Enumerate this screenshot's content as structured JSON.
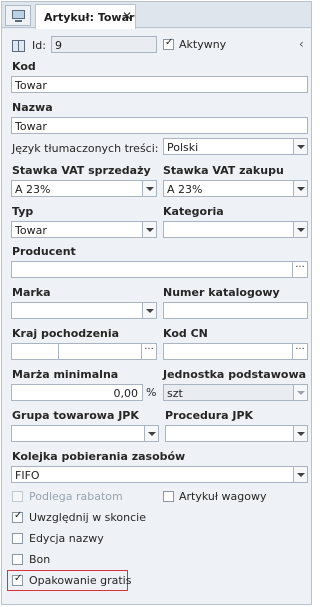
{
  "tab": {
    "title": "Artykuł: Towar",
    "close": "✕"
  },
  "header": {
    "id_label": "Id:",
    "id_value": "9",
    "aktywny_label": "Aktywny",
    "collapse": "‹"
  },
  "fields": {
    "kod": {
      "label": "Kod",
      "value": "Towar"
    },
    "nazwa": {
      "label": "Nazwa",
      "value": "Towar"
    },
    "jezyk": {
      "label": "Język tłumaczonych treści:",
      "value": "Polski"
    },
    "vat_sprzedazy": {
      "label": "Stawka VAT sprzedaży",
      "value": "A 23%"
    },
    "vat_zakupu": {
      "label": "Stawka VAT zakupu",
      "value": "A 23%"
    },
    "typ": {
      "label": "Typ",
      "value": "Towar"
    },
    "kategoria": {
      "label": "Kategoria",
      "value": ""
    },
    "producent": {
      "label": "Producent",
      "value": ""
    },
    "marka": {
      "label": "Marka",
      "value": ""
    },
    "numer_katalogowy": {
      "label": "Numer katalogowy",
      "value": ""
    },
    "kraj_pochodzenia": {
      "label": "Kraj pochodzenia",
      "value": ""
    },
    "kod_cn": {
      "label": "Kod CN",
      "value": ""
    },
    "marza": {
      "label": "Marża minimalna",
      "value": "0,00",
      "unit": "%"
    },
    "jednostka": {
      "label": "Jednostka podstawowa",
      "value": "szt"
    },
    "grupa_jpk": {
      "label": "Grupa towarowa JPK",
      "value": ""
    },
    "procedura_jpk": {
      "label": "Procedura JPK",
      "value": ""
    },
    "kolejka": {
      "label": "Kolejka pobierania zasobów",
      "value": "FIFO"
    }
  },
  "checkboxes": {
    "podlega_rabatom": {
      "label": "Podlega rabatom",
      "checked": false,
      "disabled": true
    },
    "artykul_wagowy": {
      "label": "Artykuł wagowy",
      "checked": false
    },
    "uwzglednij": {
      "label": "Uwzględnij w skoncie",
      "checked": true
    },
    "edycja_nazwy": {
      "label": "Edycja nazwy",
      "checked": false
    },
    "bon": {
      "label": "Bon",
      "checked": false
    },
    "opakowanie": {
      "label": "Opakowanie gratis",
      "checked": true
    }
  },
  "glyphs": {
    "check": "✓",
    "ellipsis": "···"
  },
  "colors": {
    "highlight": "#d8323c",
    "panel": "#eef2f6",
    "border": "#aab4c0"
  }
}
